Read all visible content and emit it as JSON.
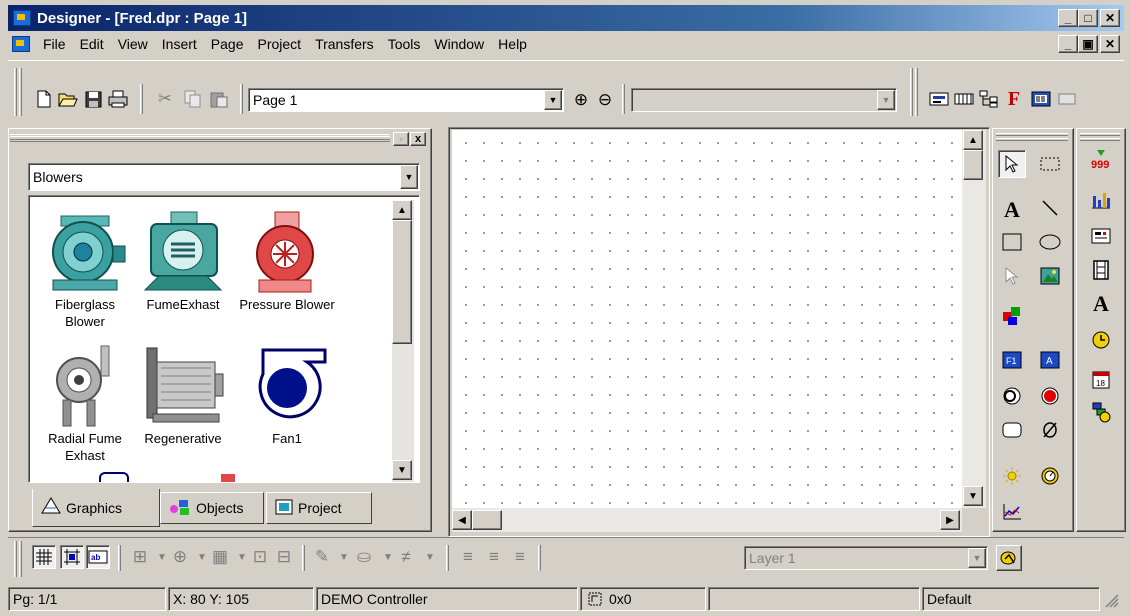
{
  "window": {
    "title": "Designer - [Fred.dpr : Page 1]",
    "buttons": [
      "_",
      "□",
      "✕"
    ],
    "doc_buttons": [
      "_",
      "▣",
      "✕"
    ]
  },
  "menu": [
    "File",
    "Edit",
    "View",
    "Insert",
    "Page",
    "Project",
    "Transfers",
    "Tools",
    "Window",
    "Help"
  ],
  "toolbar": {
    "page_combo_value": "Page 1",
    "right_combo_value": "",
    "zoom_in_icon": "⊕",
    "zoom_out_icon": "⊖"
  },
  "palette": {
    "category": "Blowers",
    "items": [
      {
        "label": "Fiberglass Blower",
        "icon": "fiberglass-blower"
      },
      {
        "label": "FumeExhast",
        "icon": "fume-exhaust"
      },
      {
        "label": "Pressure Blower",
        "icon": "pressure-blower"
      },
      {
        "label": "Radial Fume Exhast",
        "icon": "radial-fume-exhaust"
      },
      {
        "label": "Regenerative",
        "icon": "regenerative-blower"
      },
      {
        "label": "Fan1",
        "icon": "fan"
      }
    ],
    "tabs": [
      {
        "label": "Graphics",
        "icon": "graphics-icon",
        "active": true
      },
      {
        "label": "Objects",
        "icon": "objects-icon",
        "active": false
      },
      {
        "label": "Project",
        "icon": "project-icon",
        "active": false
      }
    ]
  },
  "bottom_toolbar": {
    "layer_combo_value": "Layer 1"
  },
  "status": {
    "page": "Pg: 1/1",
    "coords": "X: 80   Y: 105",
    "controller": "DEMO Controller",
    "size": "0x0",
    "extra": "",
    "mode": "Default"
  },
  "colors": {
    "title_start": "#0a246a",
    "title_end": "#a6caf0",
    "face": "#d4d0c8"
  }
}
